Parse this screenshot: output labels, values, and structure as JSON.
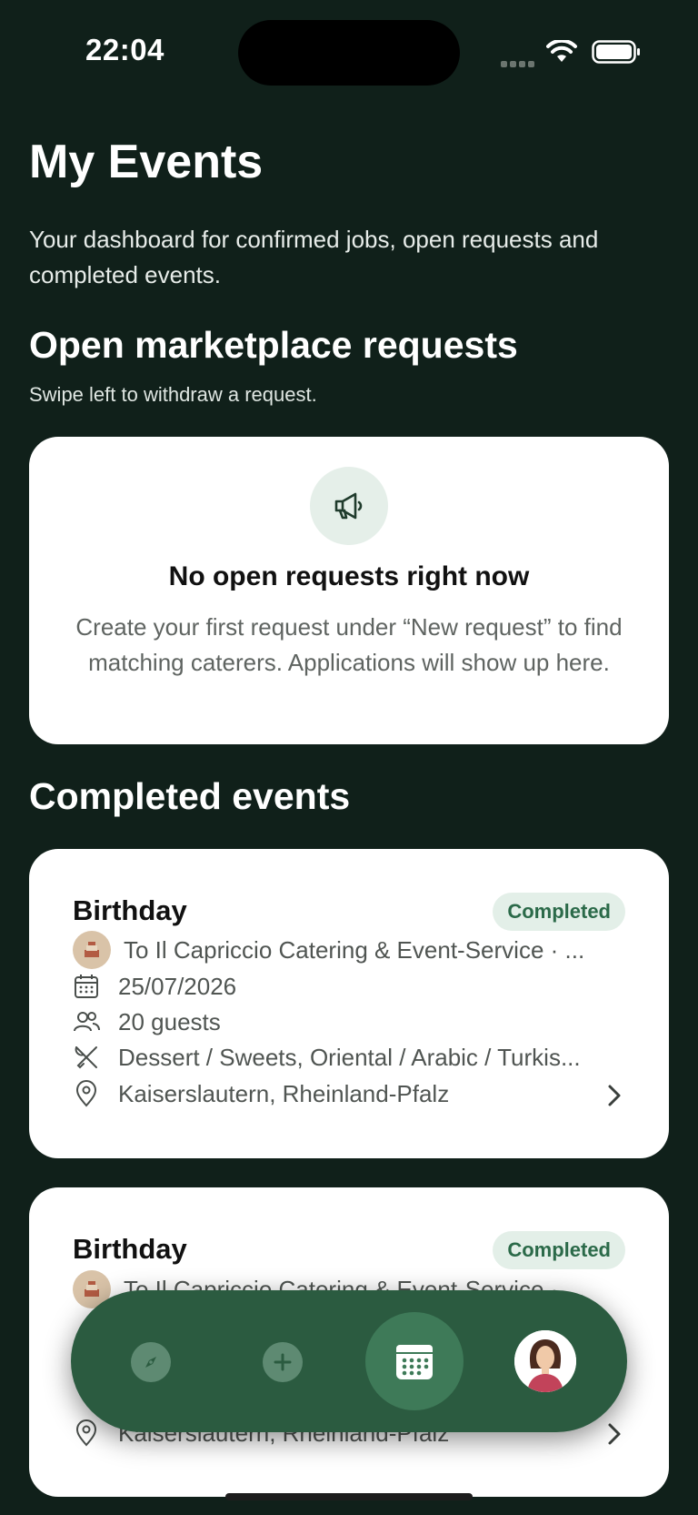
{
  "status_bar": {
    "time": "22:04"
  },
  "page": {
    "title": "My Events",
    "subtitle": "Your dashboard for confirmed jobs, open requests and completed events."
  },
  "open_requests": {
    "heading": "Open marketplace requests",
    "hint": "Swipe left to withdraw a request.",
    "empty_title": "No open requests right now",
    "empty_body": "Create your first request under “New request” to find matching caterers. Applications will show up here."
  },
  "completed": {
    "heading": "Completed events",
    "events": [
      {
        "title": "Birthday",
        "status": "Completed",
        "caterer": "To Il Capriccio Catering & Event-Service · ...",
        "date": "25/07/2026",
        "guests": "20 guests",
        "cuisine": "Dessert / Sweets, Oriental / Arabic / Turkis...",
        "location": "Kaiserslautern, Rheinland-Pfalz"
      },
      {
        "title": "Birthday",
        "status": "Completed",
        "caterer": "To Il Capriccio Catering & Event-Service · ...",
        "date": "",
        "guests": "",
        "cuisine": "",
        "location": "Kaiserslautern, Rheinland-Pfalz"
      }
    ]
  },
  "tab_bar": {
    "items": [
      {
        "icon": "compass-icon"
      },
      {
        "icon": "plus-circle-icon"
      },
      {
        "icon": "calendar-icon",
        "selected": true
      },
      {
        "icon": "profile-avatar"
      }
    ]
  },
  "colors": {
    "background": "#10201a",
    "accent": "#2b5b40",
    "badge_bg": "#e3efe8",
    "badge_text": "#2b6a49"
  }
}
